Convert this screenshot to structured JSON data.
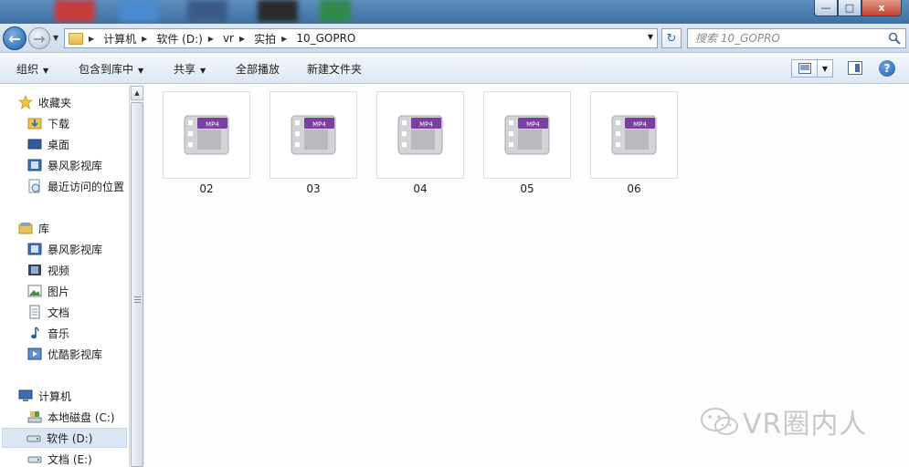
{
  "window": {
    "min_label": "—",
    "max_label": "□",
    "close_label": "x"
  },
  "address": {
    "breadcrumbs": [
      "计算机",
      "软件 (D:)",
      "vr",
      "实拍",
      "10_GOPRO"
    ]
  },
  "search": {
    "placeholder": "搜索 10_GOPRO"
  },
  "toolbar": {
    "organize": "组织",
    "include_in_library": "包含到库中",
    "share": "共享",
    "play_all": "全部播放",
    "new_folder": "新建文件夹",
    "help_label": "?"
  },
  "nav": {
    "favorites": {
      "label": "收藏夹",
      "items": [
        "下载",
        "桌面",
        "暴风影视库",
        "最近访问的位置"
      ]
    },
    "libraries": {
      "label": "库",
      "items": [
        "暴风影视库",
        "视频",
        "图片",
        "文档",
        "音乐",
        "优酷影视库"
      ]
    },
    "computer": {
      "label": "计算机",
      "items": [
        "本地磁盘 (C:)",
        "软件 (D:)",
        "文档 (E:)"
      ],
      "selected": "软件 (D:)"
    }
  },
  "files": [
    {
      "name": "02",
      "badge": "MP4"
    },
    {
      "name": "03",
      "badge": "MP4"
    },
    {
      "name": "04",
      "badge": "MP4"
    },
    {
      "name": "05",
      "badge": "MP4"
    },
    {
      "name": "06",
      "badge": "MP4"
    }
  ],
  "watermark": {
    "text": "VR圈内人"
  },
  "colors": {
    "mp4_badge": "#7b3fa0",
    "selection": "#dbe6f4",
    "toolbar": "#dde7f2"
  }
}
